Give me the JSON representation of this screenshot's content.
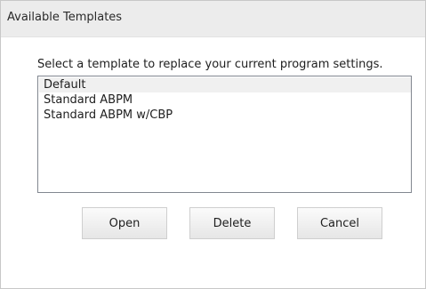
{
  "window": {
    "title": "Available Templates"
  },
  "prompt": "Select a template to replace your current program settings.",
  "template_list": {
    "items": [
      "Default",
      "Standard ABPM",
      "Standard ABPM w/CBP"
    ],
    "selected": "Default"
  },
  "buttons": {
    "open": "Open",
    "delete": "Delete",
    "cancel": "Cancel"
  }
}
